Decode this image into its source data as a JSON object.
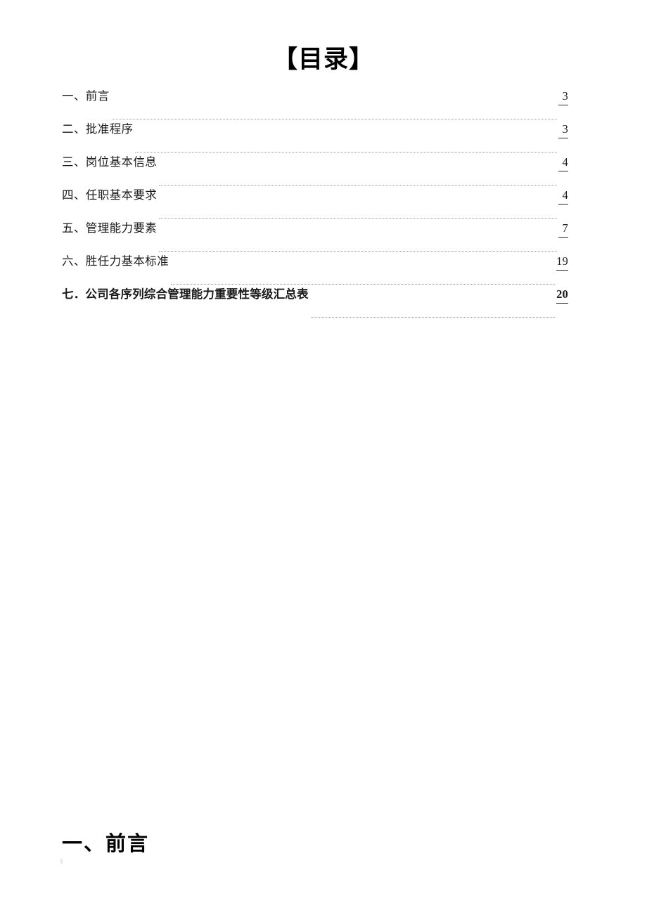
{
  "document": {
    "title": "【目录】",
    "body_heading": "一、前言"
  },
  "toc": {
    "entries": [
      {
        "label": "一、前言",
        "page": "3",
        "emphasis": false
      },
      {
        "label": "二、批准程序",
        "page": "3",
        "emphasis": false
      },
      {
        "label": "三、岗位基本信息",
        "page": "4",
        "emphasis": false
      },
      {
        "label": "四、任职基本要求",
        "page": "4",
        "emphasis": false
      },
      {
        "label": "五、管理能力要素",
        "page": "7",
        "emphasis": false
      },
      {
        "label": "六、胜任力基本标准",
        "page": "19",
        "emphasis": false
      },
      {
        "label": "七．公司各序列综合管理能力重要性等级汇总表",
        "page": "20",
        "emphasis": true
      }
    ]
  },
  "colors": {
    "page_background": "#ffffff",
    "text": "#1a1a1a",
    "title": "#000000",
    "leader_dots": "#9a9a9a",
    "page_number_rule": "#2a2a2a"
  }
}
